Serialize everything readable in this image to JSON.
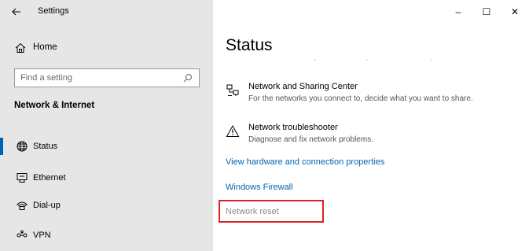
{
  "window": {
    "title": "Settings",
    "controls": {
      "minimize": "–",
      "maximize": "☐",
      "close": "✕"
    }
  },
  "sidebar": {
    "home_label": "Home",
    "search_placeholder": "Find a setting",
    "section_header": "Network & Internet",
    "items": [
      {
        "label": "Status",
        "icon": "globe-icon",
        "selected": true
      },
      {
        "label": "Ethernet",
        "icon": "ethernet-icon",
        "selected": false
      },
      {
        "label": "Dial-up",
        "icon": "dialup-icon",
        "selected": false
      },
      {
        "label": "VPN",
        "icon": "vpn-icon",
        "selected": false
      }
    ]
  },
  "main": {
    "title": "Status",
    "rows": [
      {
        "title": "Network and Sharing Center",
        "desc": "For the networks you connect to, decide what you want to share.",
        "icon": "network-sharing-icon"
      },
      {
        "title": "Network troubleshooter",
        "desc": "Diagnose and fix network problems.",
        "icon": "warning-icon"
      }
    ],
    "links": {
      "hardware": "View hardware and connection properties",
      "firewall": "Windows Firewall",
      "reset": "Network reset"
    }
  },
  "colors": {
    "accent": "#0063b1",
    "sidebar_bg": "#e6e6e6",
    "highlight": "#e01f26"
  }
}
